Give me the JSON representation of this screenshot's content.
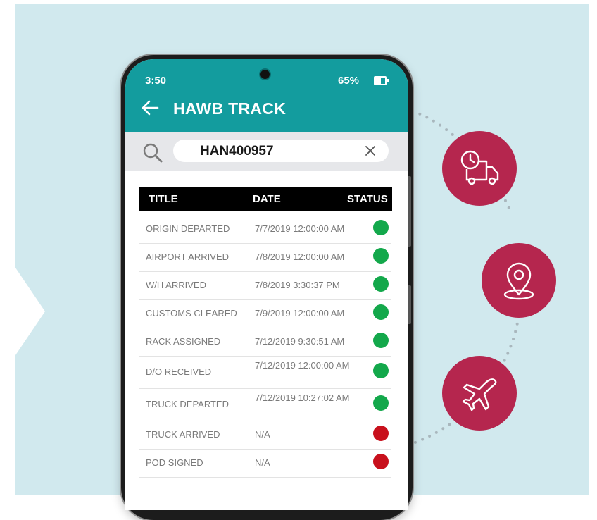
{
  "status_bar": {
    "time": "3:50",
    "battery": "65%"
  },
  "app_bar": {
    "title": "HAWB TRACK"
  },
  "search": {
    "value": "HAN400957"
  },
  "table": {
    "columns": {
      "title": "TITLE",
      "date": "DATE",
      "status": "STATUS"
    },
    "rows": [
      {
        "title": "ORIGIN DEPARTED",
        "date": "7/7/2019 12:00:00 AM",
        "status": "green"
      },
      {
        "title": "AIRPORT ARRIVED",
        "date": "7/8/2019 12:00:00 AM",
        "status": "green"
      },
      {
        "title": "W/H ARRIVED",
        "date": "7/8/2019 3:30:37 PM",
        "status": "green"
      },
      {
        "title": "CUSTOMS CLEARED",
        "date": "7/9/2019 12:00:00 AM",
        "status": "green"
      },
      {
        "title": "RACK ASSIGNED",
        "date": "7/12/2019 9:30:51 AM",
        "status": "green"
      },
      {
        "title": "D/O RECEIVED",
        "date": "7/12/2019 12:00:00 AM",
        "status": "green"
      },
      {
        "title": "TRUCK DEPARTED",
        "date": "7/12/2019 10:27:02 AM",
        "status": "green"
      },
      {
        "title": "TRUCK ARRIVED",
        "date": "N/A",
        "status": "red"
      },
      {
        "title": "POD SIGNED",
        "date": "N/A",
        "status": "red"
      }
    ]
  },
  "feature_icons": [
    "truck-clock-icon",
    "location-pin-icon",
    "airplane-icon"
  ],
  "colors": {
    "app_bar": "#139c9e",
    "background_panel": "#d1e9ee",
    "status_ok": "#13a84b",
    "status_pending": "#c8101c",
    "feature_circle": "#b5264e"
  }
}
